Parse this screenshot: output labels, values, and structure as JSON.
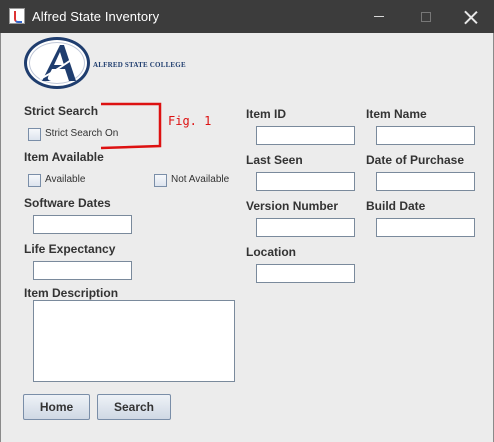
{
  "window": {
    "title": "Alfred State Inventory"
  },
  "logo": {
    "text": "Alfred State College"
  },
  "annotation": {
    "label": "Fig. 1",
    "color": "#dd1111"
  },
  "strict_search": {
    "heading": "Strict Search",
    "checkbox_label": "Strict Search On"
  },
  "item_available": {
    "heading": "Item Available",
    "available_label": "Available",
    "not_available_label": "Not Available"
  },
  "software_dates": {
    "heading": "Software Dates",
    "value": ""
  },
  "life_expectancy": {
    "heading": "Life Expectancy",
    "value": ""
  },
  "item_description": {
    "heading": "Item Description",
    "value": ""
  },
  "fields": {
    "item_id": "Item ID",
    "item_name": "Item Name",
    "last_seen": "Last Seen",
    "date_of_purchase": "Date of Purchase",
    "version_number": "Version Number",
    "build_date": "Build Date",
    "location": "Location"
  },
  "buttons": {
    "home": "Home",
    "search": "Search"
  },
  "colors": {
    "titlebar": "#3c3c3c",
    "window_bg": "#ececec",
    "brand_navy": "#1f3d6e"
  }
}
